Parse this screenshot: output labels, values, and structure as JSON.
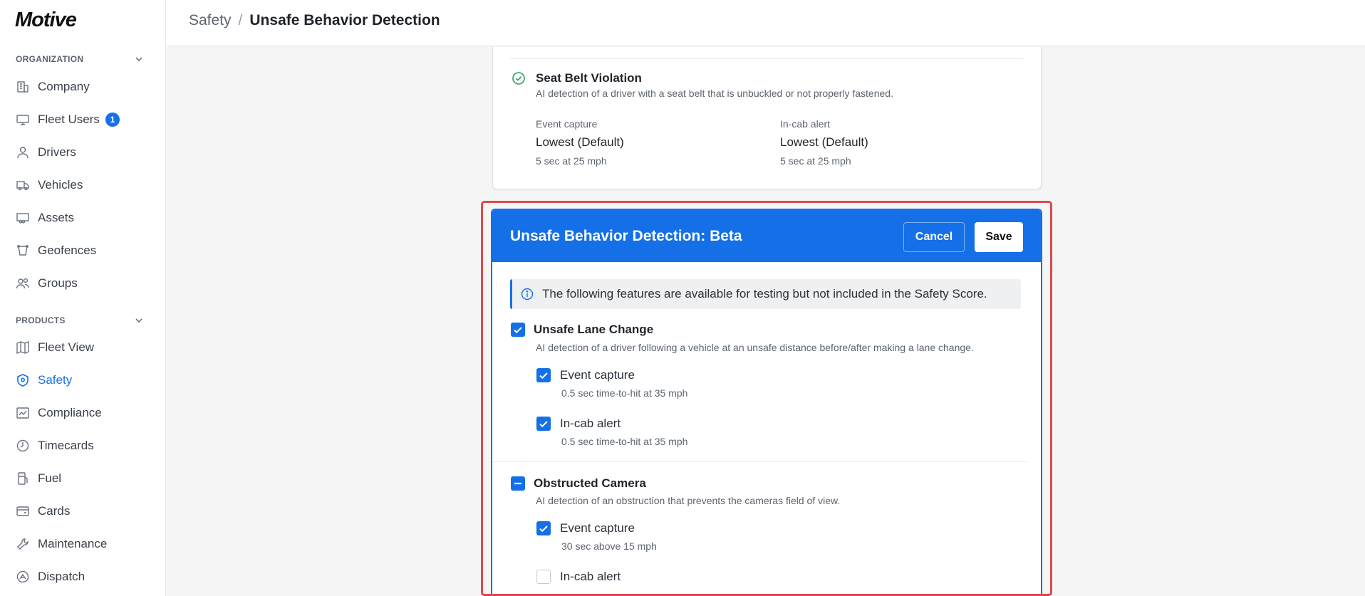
{
  "sidebar": {
    "logo": "Motive",
    "org_heading": "ORGANIZATION",
    "products_heading": "PRODUCTS",
    "org_items": [
      {
        "label": "Company",
        "icon": "building-icon"
      },
      {
        "label": "Fleet Users",
        "icon": "monitor-icon",
        "badge": "1"
      },
      {
        "label": "Drivers",
        "icon": "user-icon"
      },
      {
        "label": "Vehicles",
        "icon": "truck-icon"
      },
      {
        "label": "Assets",
        "icon": "trailer-icon"
      },
      {
        "label": "Geofences",
        "icon": "geofence-icon"
      },
      {
        "label": "Groups",
        "icon": "users-icon"
      }
    ],
    "product_items": [
      {
        "label": "Fleet View",
        "icon": "map-icon"
      },
      {
        "label": "Safety",
        "icon": "shield-icon",
        "active": true
      },
      {
        "label": "Compliance",
        "icon": "compliance-icon"
      },
      {
        "label": "Timecards",
        "icon": "clock-icon"
      },
      {
        "label": "Fuel",
        "icon": "fuel-icon"
      },
      {
        "label": "Cards",
        "icon": "card-icon"
      },
      {
        "label": "Maintenance",
        "icon": "wrench-icon"
      },
      {
        "label": "Dispatch",
        "icon": "dispatch-icon"
      }
    ]
  },
  "header": {
    "parent": "Safety",
    "separator": "/",
    "current": "Unsafe Behavior Detection"
  },
  "seat_belt": {
    "title": "Seat Belt Violation",
    "description": "AI detection of a driver with a seat belt that is unbuckled or not properly fastened.",
    "event_capture_label": "Event capture",
    "event_capture_value": "Lowest (Default)",
    "event_capture_sub": "5 sec at 25 mph",
    "alert_label": "In-cab alert",
    "alert_value": "Lowest (Default)",
    "alert_sub": "5 sec at 25 mph"
  },
  "beta": {
    "title": "Unsafe Behavior Detection: Beta",
    "cancel_label": "Cancel",
    "save_label": "Save",
    "info_text": "The following features are available for testing but not included in the Safety Score.",
    "lane_change": {
      "title": "Unsafe Lane Change",
      "checked": true,
      "description": "AI detection of a driver following a vehicle at an unsafe distance before/after making a lane change.",
      "event_capture_label": "Event capture",
      "event_capture_checked": true,
      "event_capture_sub": "0.5 sec time-to-hit at 35 mph",
      "alert_label": "In-cab alert",
      "alert_checked": true,
      "alert_sub": "0.5 sec time-to-hit at 35 mph"
    },
    "obstructed": {
      "title": "Obstructed Camera",
      "state": "indeterminate",
      "description": "AI detection of an obstruction that prevents the cameras field of view.",
      "event_capture_label": "Event capture",
      "event_capture_checked": true,
      "event_capture_sub": "30 sec above 15 mph",
      "alert_label": "In-cab alert",
      "alert_checked": false
    }
  },
  "colors": {
    "accent": "#1570e8",
    "highlight": "#e0484b"
  }
}
